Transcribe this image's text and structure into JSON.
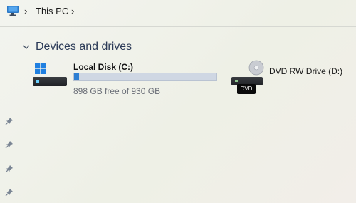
{
  "breadcrumb": {
    "location": "This PC",
    "icon": "computer-monitor-icon"
  },
  "devices_group": {
    "label": "Devices and drives",
    "drives": [
      {
        "name": "Local Disk (C:)",
        "usage_text": "898 GB free of 930 GB",
        "used_fraction": 0.035,
        "icon": "windows-drive-icon"
      },
      {
        "name": "DVD RW Drive (D:)",
        "badge": "DVD",
        "icon": "dvd-drive-icon"
      }
    ]
  },
  "quick_access_pins": [
    "pin-icon",
    "pin-icon",
    "pin-icon",
    "pin-icon"
  ],
  "colors": {
    "usage_bar": "#2d7fd3",
    "group_header": "#2b3a57",
    "secondary_text": "#6b6f78"
  }
}
